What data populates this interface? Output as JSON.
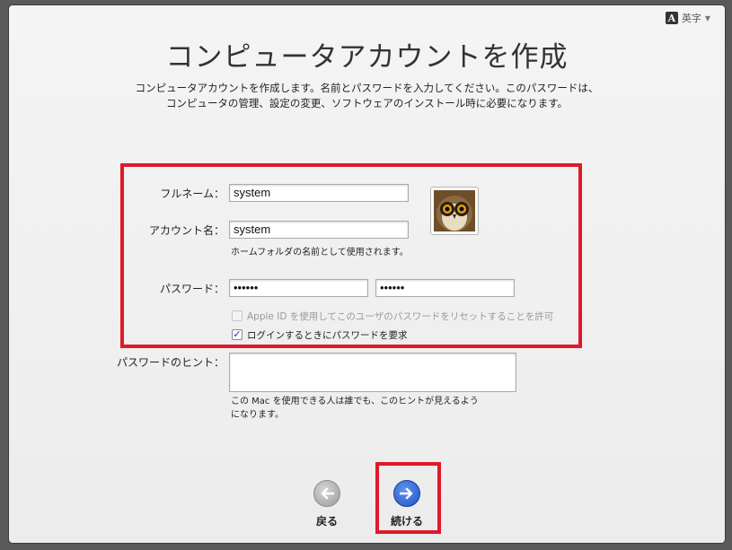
{
  "input_menu": {
    "icon": "input-source-a-icon",
    "glyph": "A",
    "label": "英字",
    "caret": "▼"
  },
  "title": "コンピュータアカウントを作成",
  "description": {
    "line1": "コンピュータアカウントを作成します。名前とパスワードを入力してください。このパスワードは、",
    "line2": "コンピュータの管理、設定の変更、ソフトウェアのインストール時に必要になります。"
  },
  "form": {
    "full_name": {
      "label": "フルネーム：",
      "value": "system"
    },
    "account_name": {
      "label": "アカウント名：",
      "value": "system",
      "note": "ホームフォルダの名前として使用されます。"
    },
    "password": {
      "label": "パスワード：",
      "value": "••••••",
      "verify_value": "••••••"
    },
    "apple_id_reset": {
      "label": "Apple ID を使用してこのユーザのパスワードをリセットすることを許可",
      "checked": false,
      "enabled": false
    },
    "require_password": {
      "label": "ログインするときにパスワードを要求",
      "checked": true,
      "mark": "✓"
    },
    "hint": {
      "label": "パスワードのヒント：",
      "value": "",
      "note_line1": "この Mac を使用できる人は誰でも、このヒントが見えるよう",
      "note_line2": "になります。"
    }
  },
  "avatar": {
    "icon": "owl-avatar-icon"
  },
  "nav": {
    "back": {
      "label": "戻る",
      "icon": "arrow-left-icon"
    },
    "continue": {
      "label": "続ける",
      "icon": "arrow-right-icon"
    }
  },
  "colors": {
    "highlight_box": "#e0192a",
    "continue_accent": "#1f54c8",
    "back_gray": "#a7a7a7"
  }
}
